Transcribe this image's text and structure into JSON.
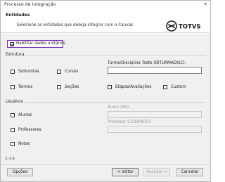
{
  "window": {
    "title": "Processo de Integração",
    "close_glyph": "✕"
  },
  "header": {
    "title": "Entidades",
    "description": "Selecione as entidades que deseja integrar com o Canvas",
    "logo_text": "TOTVS"
  },
  "habilitar": {
    "label": "Habilitar dados unitários",
    "checked": true
  },
  "estrutura": {
    "title": "Estrutura",
    "subcontas": "Subcontas",
    "cursos": "Cursos",
    "termos": "Termos",
    "secoes": "Seções",
    "etapas": "Etapas/Avaliações",
    "custom": "Custom",
    "turma_label": "Turma/Disciplina Teste (IDTURMADISC):",
    "turma_value": ""
  },
  "usuarios": {
    "title": "Usuários",
    "alunos": "Alunos",
    "professores": "Professores",
    "notas": "Notas",
    "aluno_ra_label": "Aluno (RA):",
    "professor_label": "Professor (CODPROF):"
  },
  "status_text": "1-1-1",
  "footer": {
    "opcoes": "Opções",
    "voltar": "< Voltar",
    "avancar": "Avançar >",
    "cancelar": "Cancelar"
  },
  "colors": {
    "highlight": "#7b2bb5",
    "logo_color": "#1b1b1b"
  }
}
